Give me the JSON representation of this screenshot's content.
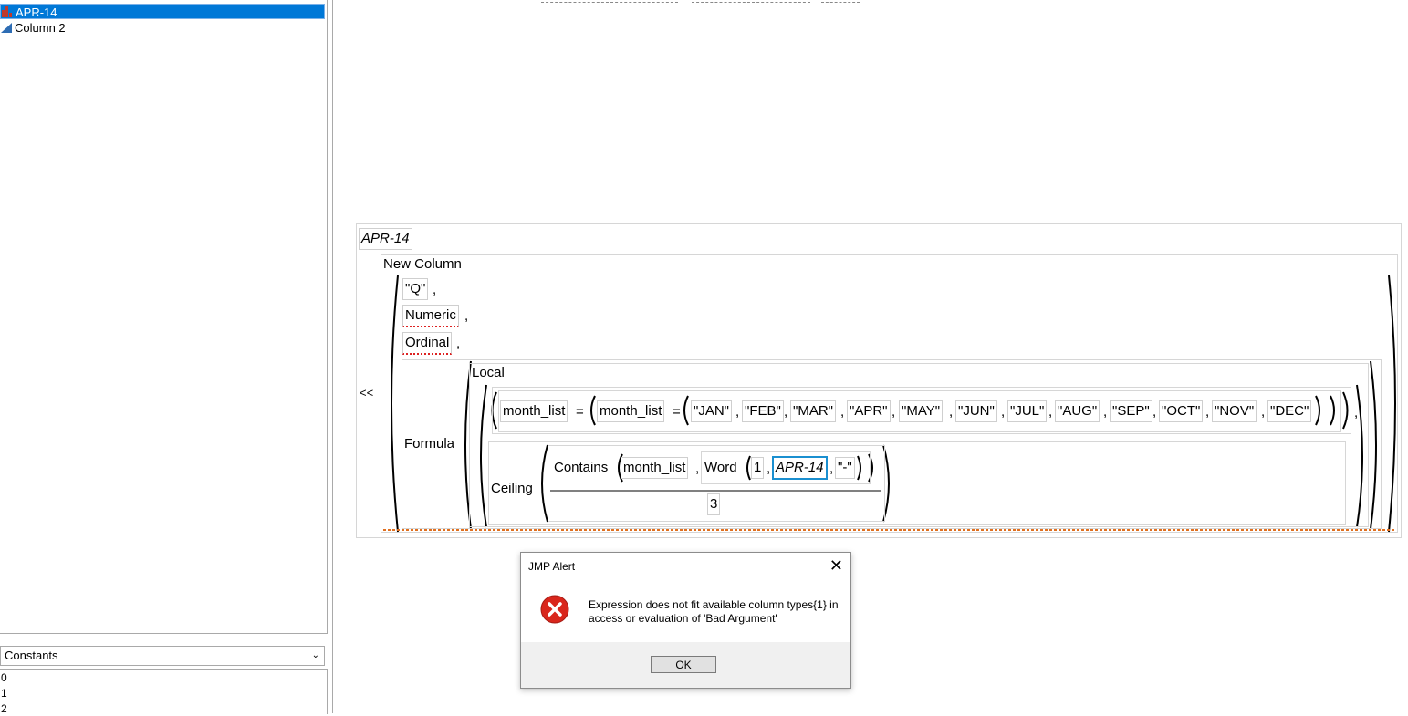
{
  "columns": {
    "items": [
      {
        "label": "APR-14",
        "icon": "bar-chart-icon",
        "selected": true
      },
      {
        "label": "Column 2",
        "icon": "continuous-triangle-icon",
        "selected": false
      }
    ]
  },
  "constants": {
    "select_value": "Constants",
    "values": [
      "0",
      "1",
      "2"
    ]
  },
  "formula": {
    "column_name": "APR-14",
    "send_op": "<<",
    "new_column": "New Column",
    "args": [
      "\"Q\"",
      "Numeric",
      "Ordinal"
    ],
    "formula_kw": "Formula",
    "local_kw": "Local",
    "var_name": "month_list",
    "assign": "=",
    "months": [
      "\"JAN\"",
      "\"FEB\"",
      "\"MAR\"",
      "\"APR\"",
      "\"MAY\"",
      "\"JUN\"",
      "\"JUL\"",
      "\"AUG\"",
      "\"SEP\"",
      "\"OCT\"",
      "\"NOV\"",
      "\"DEC\""
    ],
    "ceiling_kw": "Ceiling",
    "contains_kw": "Contains",
    "word_kw": "Word",
    "word_index": "1",
    "word_col": "APR-14",
    "word_delim": "\"-\"",
    "divisor": "3",
    "comma": ","
  },
  "dialog": {
    "title": "JMP Alert",
    "message_line1": "Expression does not fit available column types{1} in",
    "message_line2": "access or evaluation of 'Bad Argument'",
    "ok_label": "OK",
    "icon": "error-icon"
  }
}
